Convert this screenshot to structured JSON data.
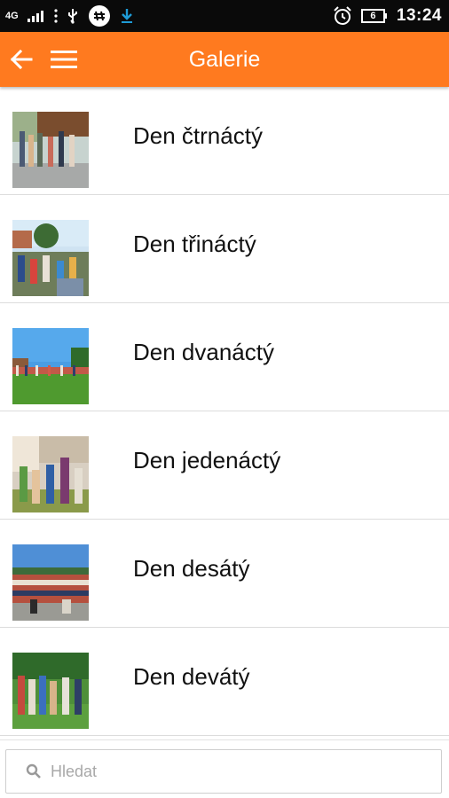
{
  "status_bar": {
    "network": "4G",
    "time": "13:24",
    "battery": "6"
  },
  "app_bar": {
    "title": "Galerie",
    "back_icon": "arrow-left-icon",
    "menu_icon": "hamburger-menu-icon"
  },
  "gallery": {
    "items": [
      {
        "label": "Den čtrnáctý"
      },
      {
        "label": "Den třináctý"
      },
      {
        "label": "Den dvanáctý"
      },
      {
        "label": "Den jedenáctý"
      },
      {
        "label": "Den desátý"
      },
      {
        "label": "Den devátý"
      }
    ]
  },
  "search": {
    "placeholder": "Hledat",
    "icon": "search-icon"
  },
  "colors": {
    "accent": "#ff7a1f",
    "status_bar": "#0a0a0a"
  }
}
